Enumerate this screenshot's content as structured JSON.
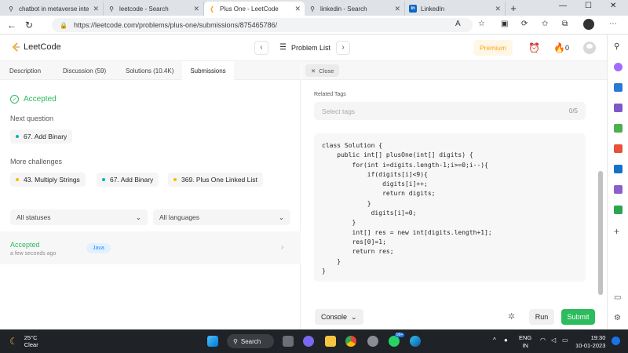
{
  "browser": {
    "tabs": [
      {
        "title": "chatbot in metaverse inte",
        "icon": "search-icon",
        "active": false
      },
      {
        "title": "leetcode - Search",
        "icon": "search-icon",
        "active": false
      },
      {
        "title": "Plus One - LeetCode",
        "icon": "leetcode-icon",
        "active": true
      },
      {
        "title": "linkedin - Search",
        "icon": "search-icon",
        "active": false
      },
      {
        "title": "LinkedIn",
        "icon": "linkedin-icon",
        "active": false
      }
    ],
    "url": "https://leetcode.com/problems/plus-one/submissions/875465786/"
  },
  "header": {
    "logo_text": "LeetCode",
    "problem_list": "Problem List",
    "premium": "Premium",
    "streak_count": "0"
  },
  "left": {
    "tabs": [
      "Description",
      "Discussion (59)",
      "Solutions (10.4K)",
      "Submissions"
    ],
    "status": "Accepted",
    "next_question_title": "Next question",
    "next_question": "67. Add Binary",
    "more_challenges_title": "More challenges",
    "challenges": [
      "43. Multiply Strings",
      "67. Add Binary",
      "369. Plus One Linked List"
    ],
    "filter_status": "All statuses",
    "filter_language": "All languages",
    "submission": {
      "status": "Accepted",
      "time": "a few seconds ago",
      "language": "Java"
    }
  },
  "right": {
    "close": "Close",
    "related_tags": "Related Tags",
    "select_tags_placeholder": "Select tags",
    "tag_count": "0/5",
    "code": "class Solution {\n    public int[] plusOne(int[] digits) {\n        for(int i=digits.length-1;i>=0;i--){\n            if(digits[i]<9){\n                digits[i]++;\n                return digits;\n            }\n             digits[i]=0;\n        }\n        int[] res = new int[digits.length+1];\n        res[0]=1;\n        return res;\n    }\n}",
    "console": "Console",
    "run": "Run",
    "submit": "Submit"
  },
  "taskbar": {
    "temperature": "25°C",
    "weather": "Clear",
    "search": "Search",
    "language_line1": "ENG",
    "language_line2": "IN",
    "time": "19:30",
    "date": "10-01-2023",
    "badge": "99+"
  },
  "colors": {
    "accepted_green": "#2cbb5d",
    "leetcode_orange": "#ffa116",
    "java_blue": "#1a90ff"
  }
}
